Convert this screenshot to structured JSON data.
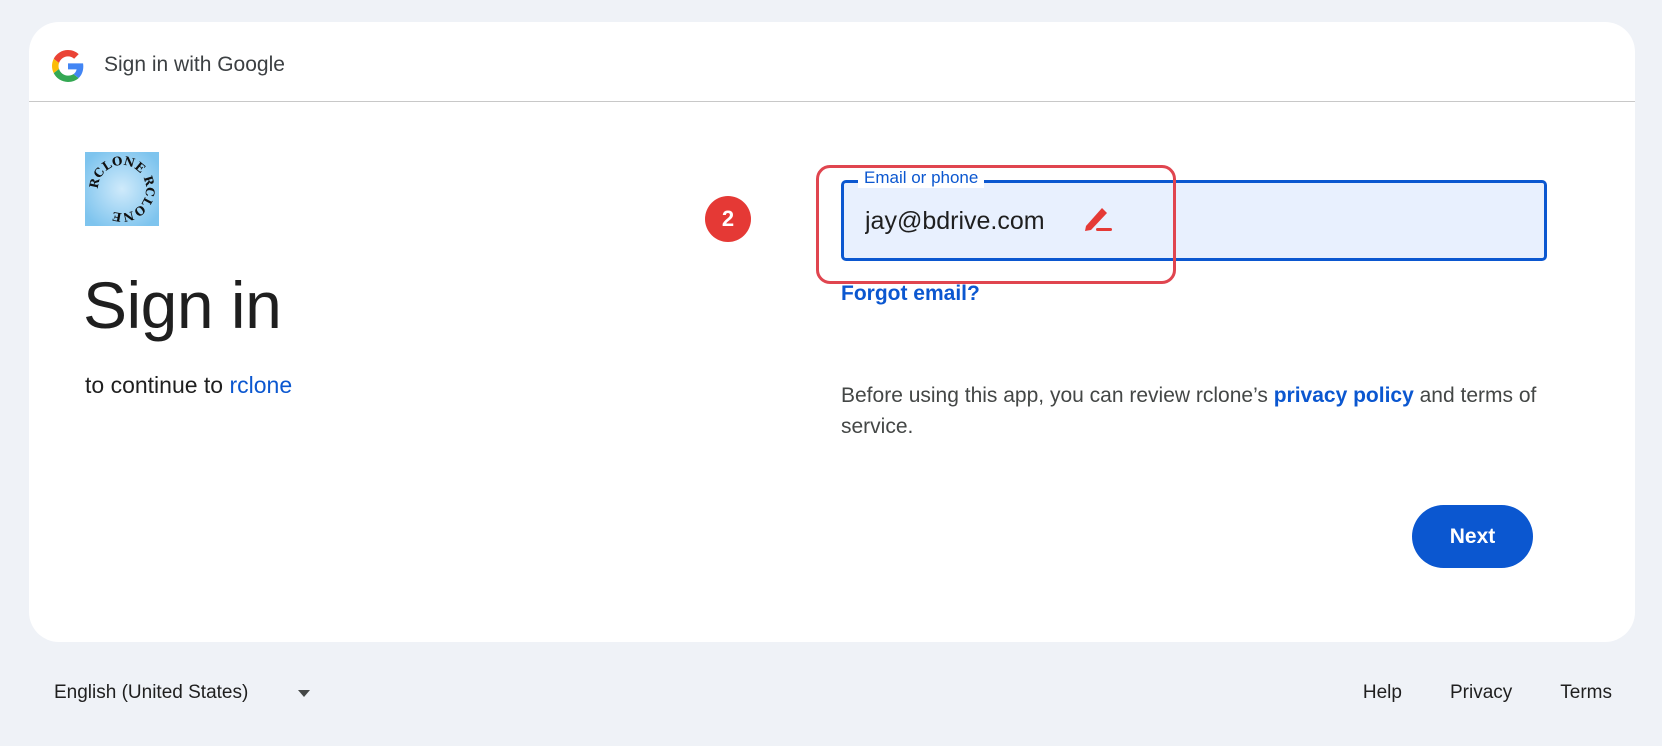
{
  "header": {
    "title": "Sign in with Google",
    "logo_icon": "google-g-icon"
  },
  "app": {
    "logo_text": "RCLONE RCLONE",
    "logo_icon": "rclone-logo"
  },
  "main": {
    "heading": "Sign in",
    "continue_prefix": "to continue to",
    "continue_app": "rclone"
  },
  "step_badge": "2",
  "email_field": {
    "label": "Email or phone",
    "value": "jay@bdrive.com",
    "annotation_icon": "pencil-icon"
  },
  "forgot_email": "Forgot email?",
  "privacy": {
    "prefix": "Before using this app, you can review rclone’s",
    "link": "privacy policy",
    "suffix": "and terms of service."
  },
  "next_button": "Next",
  "footer": {
    "language": "English (United States)",
    "links": [
      "Help",
      "Privacy",
      "Terms"
    ]
  },
  "colors": {
    "accent": "#0b57d0",
    "annotation": "#e53935",
    "background": "#eff2f7"
  }
}
